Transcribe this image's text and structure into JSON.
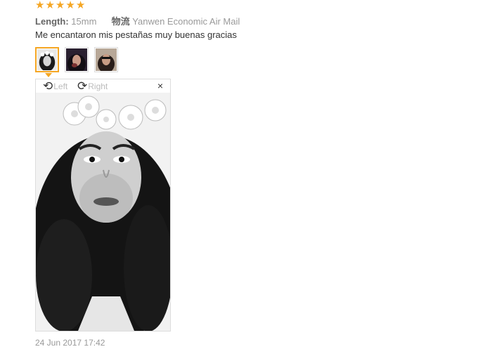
{
  "review": {
    "rating": 5,
    "length_label": "Length:",
    "length_value": "15mm",
    "shipping_label": "物流",
    "shipping_value": "Yanwen Economic Air Mail",
    "comment": "Me encantaron mis pestañas muy buenas gracias",
    "date": "24 Jun 2017 17:42"
  },
  "viewer": {
    "left_label": "Left",
    "right_label": "Right",
    "close_icon": "×",
    "rotate_left_icon": "⟲",
    "rotate_right_icon": "⟳"
  },
  "icons": {
    "star": "★"
  },
  "colors": {
    "accent": "#f5a623",
    "muted_text": "#999999"
  }
}
